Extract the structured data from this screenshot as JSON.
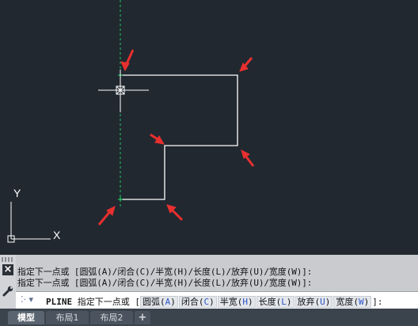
{
  "viewport": {
    "ucs": {
      "y_label": "Y",
      "x_label": "X"
    }
  },
  "command": {
    "history": [
      "指定下一点或 [圆弧(A)/闭合(C)/半宽(H)/长度(L)/放弃(U)/宽度(W)]:",
      "指定下一点或 [圆弧(A)/闭合(C)/半宽(H)/长度(L)/放弃(U)/宽度(W)]:"
    ],
    "close_icon": "×",
    "prompt_icon": "⁚· ▾",
    "name": "PLINE",
    "prompt": "指定下一点或 [",
    "options": [
      {
        "label": "圆弧(",
        "key": "A",
        "end": ")"
      },
      {
        "label": "闭合(",
        "key": "C",
        "end": ")"
      },
      {
        "label": "半宽(",
        "key": "H",
        "end": ")"
      },
      {
        "label": "长度(",
        "key": "L",
        "end": ")"
      },
      {
        "label": "放弃(",
        "key": "U",
        "end": ")"
      },
      {
        "label": "宽度(",
        "key": "W",
        "end": ")"
      }
    ],
    "prompt_end": "]:"
  },
  "tabs": [
    {
      "label": "模型",
      "active": true
    },
    {
      "label": "布局1",
      "active": false
    },
    {
      "label": "布局2",
      "active": false
    },
    {
      "label": "+",
      "active": false
    }
  ],
  "colors": {
    "canvas": "#212830",
    "polyline": "#ffffff",
    "tracking": "#22c55e",
    "arrow": "#e8302f",
    "option_key": "#2c55c9"
  }
}
